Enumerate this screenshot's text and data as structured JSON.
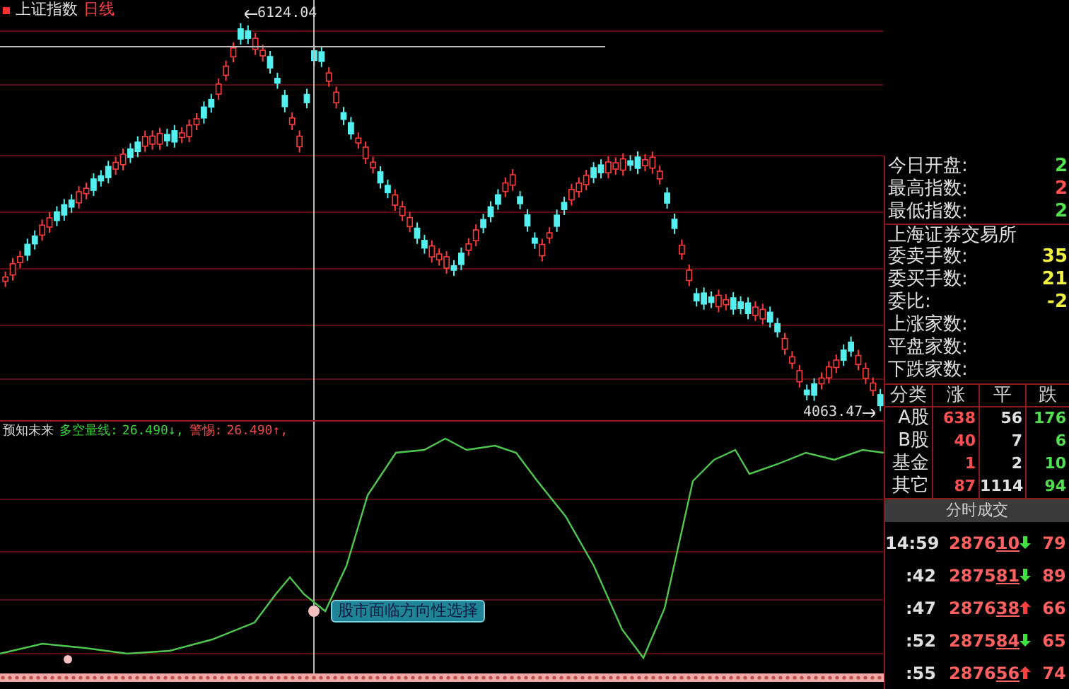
{
  "chart_header": {
    "name": "上证指数",
    "period": "日线"
  },
  "high_label": "6124.04",
  "low_label": "4063.47",
  "indicator": {
    "name": "预知未来",
    "items": [
      {
        "label": "多空量线:",
        "value": "26.490↓,",
        "color": "#3cd23c"
      },
      {
        "label": "警惕:",
        "value": "26.490↑,",
        "color": "#e84a4a"
      }
    ]
  },
  "annotation": "股市面临方向性选择",
  "quote_panel": {
    "rows": [
      {
        "label": "今日开盘:",
        "value": "2",
        "color": "#50e050"
      },
      {
        "label": "最高指数:",
        "value": "2",
        "color": "#ff5050"
      },
      {
        "label": "最低指数:",
        "value": "2",
        "color": "#50e050"
      }
    ],
    "exchange": "上海证券交易所",
    "order_rows": [
      {
        "label": "委卖手数:",
        "value": "35",
        "color": "#f0f040"
      },
      {
        "label": "委买手数:",
        "value": "21",
        "color": "#f0f040"
      },
      {
        "label": "委比:",
        "value": "-2",
        "color": "#f0f040"
      },
      {
        "label": "上涨家数:"
      },
      {
        "label": "平盘家数:"
      },
      {
        "label": "下跌家数:"
      }
    ]
  },
  "breadth_table": {
    "columns": [
      "分类",
      "涨",
      "平",
      "跌"
    ],
    "rows": [
      [
        "A股",
        "638",
        "56",
        "176"
      ],
      [
        "B股",
        "40",
        "7",
        "6"
      ],
      [
        "基金",
        "1",
        "2",
        "10"
      ],
      [
        "其它",
        "87",
        "1114",
        "94"
      ]
    ]
  },
  "ticks": {
    "title": "分时成交",
    "rows": [
      {
        "time": "14:59",
        "price": "2876",
        "price_tail": "10",
        "rising": false,
        "volume": "79"
      },
      {
        "time": ":42",
        "price": "2875",
        "price_tail": "81",
        "rising": false,
        "volume": "89"
      },
      {
        "time": ":47",
        "price": "2876",
        "price_tail": "38",
        "rising": true,
        "volume": "66"
      },
      {
        "time": ":52",
        "price": "2875",
        "price_tail": "84",
        "rising": false,
        "volume": "65"
      },
      {
        "time": ":55",
        "price": "2876",
        "price_tail": "56",
        "rising": true,
        "volume": "74"
      }
    ]
  }
}
